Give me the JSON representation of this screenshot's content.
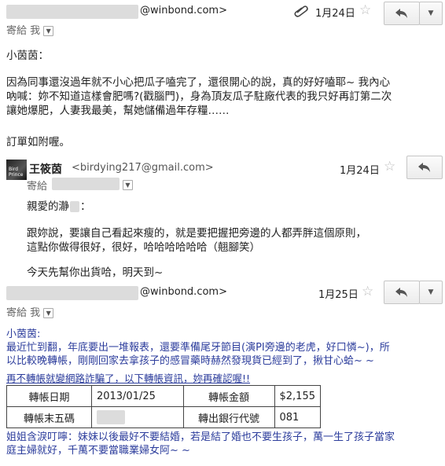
{
  "email1": {
    "sender_email": "@winbond.com>",
    "date": "1月24日",
    "to_label": "寄給 我",
    "greeting": "小茵茵：",
    "body_lines": [
      "因為同事還沒過年就不小心把瓜子嗑完了，還很開心的說，真的好好嗑耶~ 我內心",
      "吶喊：妳不知道這樣會肥嗎?(戳腦門)，身為頂友瓜子駐廠代表的我只好再訂第二次",
      "讓她爆肥，人妻我最美，幫她儲備過年存糧……"
    ],
    "closing": "訂單如附喔。"
  },
  "email2": {
    "sender_name": "王筱茵",
    "sender_email": "<birdying217@gmail.com>",
    "date": "1月24日",
    "to_label": "寄給",
    "avatar_text": "Bird Prince",
    "greeting": "親愛的瀞",
    "greeting_end": "：",
    "body_lines": [
      "跟妳說，要讓自己看起來瘦的，就是要把握把旁邊的人都弄胖這個原則，",
      "這點你做得很好，很好，哈哈哈哈哈哈（翹腳笑）"
    ],
    "closing": "今天先幫你出貨哈，明天到~"
  },
  "email3": {
    "sender_email": "@winbond.com>",
    "date": "1月25日",
    "to_label": "寄給 我",
    "greeting": "小茵茵:",
    "body_lines": [
      "最近忙到翻，年底要出一堆報表，還要準備尾牙節目(演PI旁邊的老虎，好口憐~)，所",
      "以比較晚轉帳，剛剛回家去拿孩子的感冒藥時赫然發現貨已經到了，揪甘心蛤~ ~"
    ],
    "warning": "再不轉帳就變網路詐騙了，以下轉帳資訊，妳再確認喔!!",
    "table": {
      "row1": {
        "label_a": "轉帳日期",
        "value_a": "2013/01/25",
        "label_b": "轉帳金額",
        "value_b": "$2,155"
      },
      "row2": {
        "label_a": "轉帳末五碼",
        "value_a": "",
        "label_b": "轉出銀行代號",
        "value_b": "081"
      }
    },
    "footer_lines": [
      "姐姐含淚叮嚀：妹妹以後最好不要結婚，若是結了婚也不要生孩子，萬一生了孩子當家",
      "庭主婦就好，千萬不要當職業婦女阿~ ~"
    ]
  },
  "icons": {
    "paperclip": "paperclip-icon",
    "reply": "reply-icon",
    "more": "chevron-down-icon",
    "star": "star-icon"
  }
}
